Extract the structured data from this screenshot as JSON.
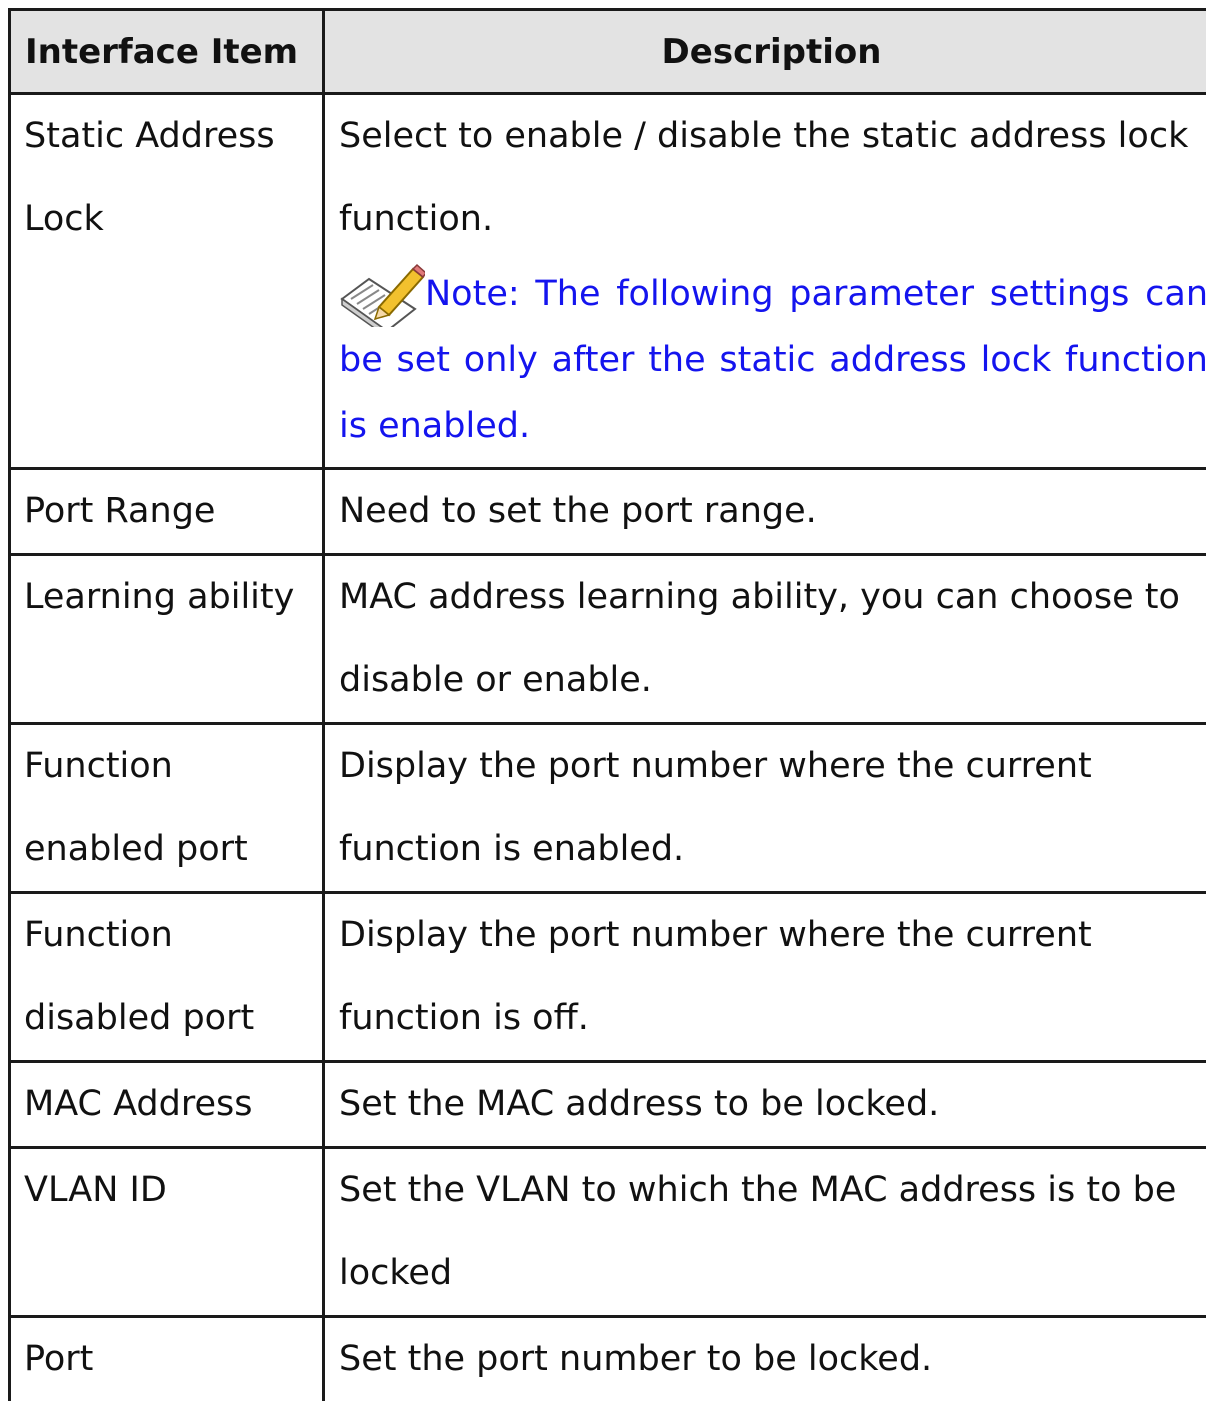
{
  "table": {
    "headers": [
      "Interface Item",
      "Description"
    ],
    "rows": [
      {
        "item": "Static Address Lock",
        "description": "Select to enable / disable the static address lock function."
      },
      {
        "item": "Port Range",
        "description": "Need to set the port range."
      },
      {
        "item": "Learning ability",
        "description": "MAC address learning ability, you can choose to disable or enable."
      },
      {
        "item": "Function enabled port",
        "description": "Display the port number where the current function is enabled."
      },
      {
        "item": "Function disabled port",
        "description": "Display the port number where the current function is off."
      },
      {
        "item": "MAC Address",
        "description": "Set the MAC address to be locked."
      },
      {
        "item": "VLAN ID",
        "description": "Set the VLAN to which the MAC address is to be locked"
      },
      {
        "item": "Port",
        "description": "Set the port number to be locked."
      }
    ],
    "note": "Note: The following parameter settings can be set only after the static address lock function is enabled.",
    "note_icon": "note-pencil-icon",
    "note_color": "#1414ee",
    "header_bg": "#e3e3e3"
  }
}
